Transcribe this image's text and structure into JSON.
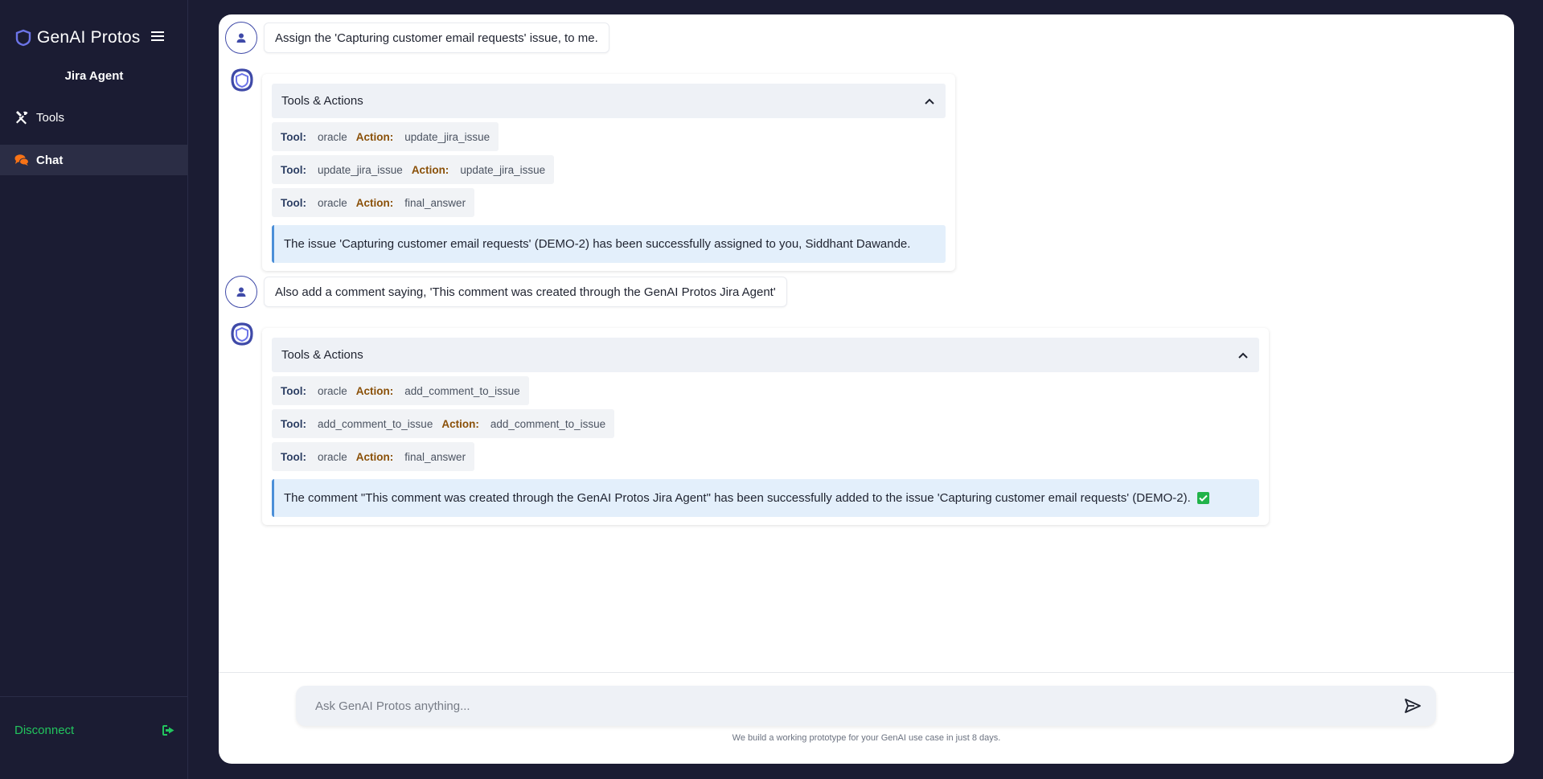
{
  "app": {
    "brand": "GenAI Protos",
    "agent_name": "Jira Agent"
  },
  "sidebar": {
    "items": [
      {
        "label": "Tools",
        "icon": "tools-icon",
        "active": false
      },
      {
        "label": "Chat",
        "icon": "chat-icon",
        "active": true
      }
    ],
    "disconnect_label": "Disconnect"
  },
  "conversation": [
    {
      "user_message": "Assign the 'Capturing customer email requests' issue, to me.",
      "tools_header": "Tools & Actions",
      "tool_label": "Tool:",
      "action_label": "Action:",
      "steps": [
        {
          "tool": "oracle",
          "action": "update_jira_issue"
        },
        {
          "tool": "update_jira_issue",
          "action": "update_jira_issue"
        },
        {
          "tool": "oracle",
          "action": "final_answer"
        }
      ],
      "answer": "The issue 'Capturing customer email requests' (DEMO-2) has been successfully assigned to you, Siddhant Dawande."
    },
    {
      "user_message": "Also add a comment saying, 'This comment was created through the GenAI Protos Jira Agent'",
      "tools_header": "Tools & Actions",
      "tool_label": "Tool:",
      "action_label": "Action:",
      "steps": [
        {
          "tool": "oracle",
          "action": "add_comment_to_issue"
        },
        {
          "tool": "add_comment_to_issue",
          "action": "add_comment_to_issue"
        },
        {
          "tool": "oracle",
          "action": "final_answer"
        }
      ],
      "answer": "The comment \"This comment was created through the GenAI Protos Jira Agent\" has been successfully added to the issue 'Capturing customer email requests' (DEMO-2)."
    }
  ],
  "input": {
    "placeholder": "Ask GenAI Protos anything...",
    "value": ""
  },
  "footer_note": "We build a working prototype for your GenAI use case in just 8 days.",
  "colors": {
    "sidebar_bg": "#1b1c33",
    "accent_blue": "#3f4aa8",
    "chat_icon": "#f97316",
    "disconnect_green": "#22c55e",
    "answer_bg": "#e3effb",
    "answer_border": "#4b8fd8",
    "check_green": "#21b34a"
  }
}
